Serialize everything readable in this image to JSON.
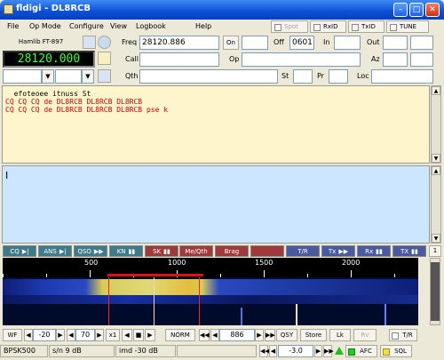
{
  "window": {
    "title": "fldigi - DL8RCB"
  },
  "menu": {
    "items": [
      "File",
      "Op Mode",
      "Configure",
      "View",
      "Logbook",
      "Help"
    ]
  },
  "toggles": {
    "spot": "Spot",
    "rxid": "RxID",
    "txid": "TxID",
    "tune": "TUNE"
  },
  "rig": {
    "name": "Hamlib FT-897",
    "frequency_display": "28120.000"
  },
  "log": {
    "freq_label": "Freq",
    "freq_value": "28120.886",
    "on_label": "On",
    "on_value": "",
    "off_label": "Off",
    "off_value": "0601",
    "in_label": "In",
    "in_value": "",
    "out_label": "Out",
    "out_value": "",
    "call_label": "Call",
    "call_value": "",
    "op_label": "Op",
    "op_value": "",
    "az_label": "Az",
    "az_value": "",
    "qth_label": "Qth",
    "qth_value": "",
    "st_label": "St",
    "st_value": "",
    "pr_label": "Pr",
    "pr_value": "",
    "loc_label": "Loc",
    "loc_value": ""
  },
  "rx_text": {
    "lines": [
      {
        "text": "  efoteoee itnuss St",
        "color": "#000000"
      },
      {
        "text": "CQ CQ CQ de DL8RCB DL8RCB DL8RCB",
        "color": "#cc0000"
      },
      {
        "text": "CQ CQ CQ de DL8RCB DL8RCB DL8RCB pse k",
        "color": "#cc0000"
      }
    ]
  },
  "tx_text": {
    "value": ""
  },
  "macros": [
    {
      "label": "CQ",
      "glyph": "▶|",
      "color": "teal"
    },
    {
      "label": "ANS",
      "glyph": "▶|",
      "color": "teal"
    },
    {
      "label": "QSO",
      "glyph": "▶▶",
      "color": "teal"
    },
    {
      "label": "KN",
      "glyph": "▮▮",
      "color": "teal"
    },
    {
      "label": "SK",
      "glyph": "▮▮",
      "color": "red"
    },
    {
      "label": "Me/Qth",
      "glyph": "",
      "color": "red"
    },
    {
      "label": "Brag",
      "glyph": "",
      "color": "red"
    },
    {
      "label": "",
      "glyph": "",
      "color": "red"
    },
    {
      "label": "T/R",
      "glyph": "",
      "color": "blue"
    },
    {
      "label": "Tx",
      "glyph": "▶▶",
      "color": "blue"
    },
    {
      "label": "Rx",
      "glyph": "▮▮",
      "color": "blue"
    },
    {
      "label": "TX",
      "glyph": "▮▮",
      "color": "blue"
    }
  ],
  "macro_set": "1",
  "scale": {
    "labels": [
      "500",
      "1000",
      "1500",
      "2000"
    ]
  },
  "waterfall_controls": {
    "wf": "WF",
    "ref_level": "-20",
    "range": "70",
    "zoom": "x1",
    "norm": "NORM",
    "carrier": "886",
    "qsy": "QSY",
    "store": "Store",
    "lk": "Lk",
    "rv": "Rv",
    "tr": "T/R"
  },
  "status": {
    "mode": "BPSK500",
    "sn": "s/n  9 dB",
    "imd": "imd -30 dB",
    "afc_value": "-3.0",
    "afc": "AFC",
    "sql": "SQL"
  },
  "colors": {
    "rx_bg": "#fff5cc",
    "tx_bg": "#cce6ff",
    "accent": "#0a4fd4",
    "rx_red": "#cc0000"
  }
}
